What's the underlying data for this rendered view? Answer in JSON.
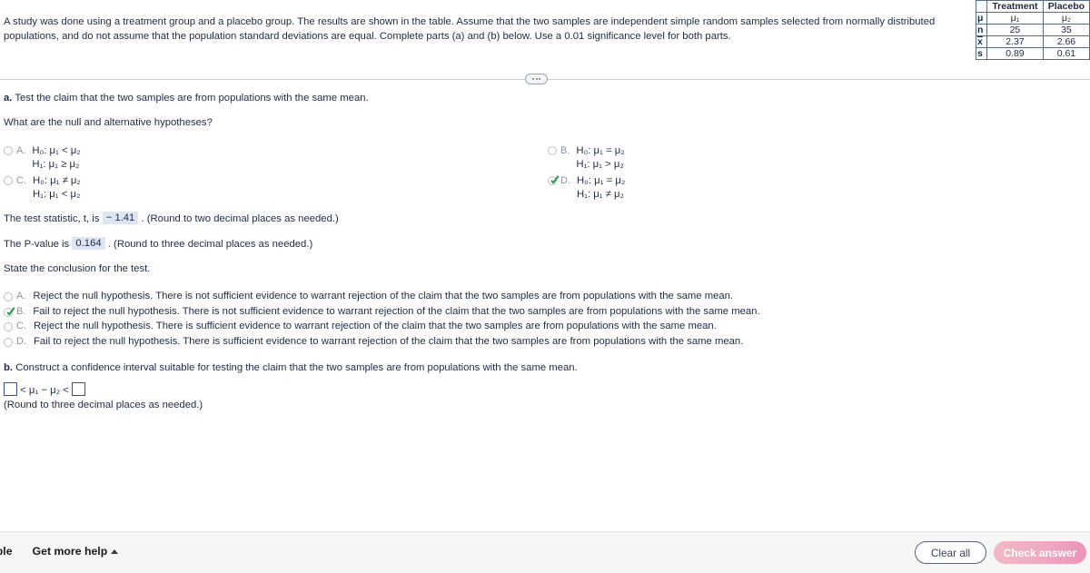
{
  "problem": {
    "statement": "A study was done using a treatment group and a placebo group. The results are shown in the table. Assume that the two samples are independent simple random samples selected from normally distributed populations, and do not assume that the population standard deviations are equal. Complete parts (a) and (b) below. Use a 0.01 significance level for both parts."
  },
  "data_table": {
    "columns": [
      "",
      "Treatment",
      "Placebo"
    ],
    "rows": [
      {
        "label": "μ",
        "treatment": "μ₁",
        "placebo": "μ₂"
      },
      {
        "label": "n",
        "treatment": "25",
        "placebo": "35"
      },
      {
        "label": "x",
        "label_is_xbar": true,
        "treatment": "2.37",
        "placebo": "2.66"
      },
      {
        "label": "s",
        "treatment": "0.89",
        "placebo": "0.61"
      }
    ]
  },
  "part_a": {
    "prompt_lead": "a.",
    "prompt": "Test the claim that the two samples are from populations with the same mean.",
    "hypotheses_question": "What are the null and alternative hypotheses?",
    "options": [
      {
        "letter": "A.",
        "h0": "H₀: μ₁ < μ₂",
        "h1": "H₁: μ₁ ≥ μ₂",
        "selected": false
      },
      {
        "letter": "B.",
        "h0": "H₀: μ₁ = μ₂",
        "h1": "H₁: μ₁ > μ₂",
        "selected": false
      },
      {
        "letter": "C.",
        "h0": "H₀: μ₁ ≠ μ₂",
        "h1": "H₁: μ₁ < μ₂",
        "selected": false
      },
      {
        "letter": "D.",
        "h0": "H₀: μ₁ = μ₂",
        "h1": "H₁: μ₁ ≠ μ₂",
        "selected": true
      }
    ],
    "test_statistic": {
      "label_before": "The test statistic, t, is",
      "value": "− 1.41",
      "label_after": ". (Round to two decimal places as needed.)"
    },
    "p_value": {
      "label_before": "The P-value is",
      "value": "0.164",
      "label_after": ". (Round to three decimal places as needed.)"
    },
    "conclusion_prompt": "State the conclusion for the test.",
    "conclusion_options": [
      {
        "letter": "A.",
        "text": "Reject the null hypothesis. There is not sufficient evidence to warrant rejection of the claim that the two samples are from populations with the same mean.",
        "selected": false
      },
      {
        "letter": "B.",
        "text": "Fail to reject the null hypothesis. There is not sufficient evidence to warrant rejection of the claim that the two samples are from populations with the same mean.",
        "selected": true
      },
      {
        "letter": "C.",
        "text": "Reject the null hypothesis. There is sufficient evidence to warrant rejection of the claim that the two samples are from populations with the same mean.",
        "selected": false
      },
      {
        "letter": "D.",
        "text": "Fail to reject the null hypothesis. There is sufficient evidence to warrant rejection of the claim that the two samples are from populations with the same mean.",
        "selected": false
      }
    ]
  },
  "part_b": {
    "prompt_lead": "b.",
    "prompt": "Construct a confidence interval suitable for testing the claim that the two samples are from populations with the same mean.",
    "ci_middle": "< μ₁ − μ₂ <",
    "ci_lower_value": "",
    "ci_upper_value": "",
    "note": "(Round to three decimal places as needed.)"
  },
  "toolbar": {
    "example_label": "ample",
    "help_label": "Get more help",
    "clear_all_label": "Clear all",
    "check_answer_label": "Check answer"
  },
  "colors": {
    "text": "#1f2a44",
    "muted": "#8b95a5",
    "answer_fill": "#dde6f2",
    "input_border": "#3b4fa0",
    "check_green": "#169b3b",
    "check_answer_pink": "#eb94b9"
  }
}
